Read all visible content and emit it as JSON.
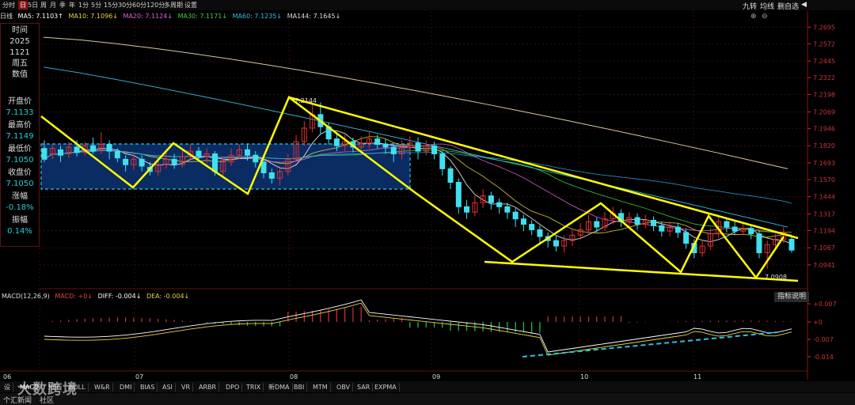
{
  "toolbar": {
    "items": [
      "分时",
      "日",
      "5日",
      "周",
      "月",
      "季",
      "年",
      "1分",
      "5分",
      "15分",
      "30分",
      "60分",
      "120分",
      "多周期",
      "设置"
    ],
    "active": "日",
    "right": [
      "九转",
      "均线",
      "删自选"
    ]
  },
  "ma_line": {
    "period": "日线",
    "ma5": "MA5: 7.1103↑",
    "ma10": "MA10: 7.1096↓",
    "ma20": "MA20: 7.1124↓",
    "ma30": "MA30: 7.1171↓",
    "ma60": "MA60: 7.1235↓",
    "ma144": "MA144: 7.1645↓",
    "colors": {
      "ma5": "#ffffff",
      "ma10": "#e8d23a",
      "ma20": "#e060e0",
      "ma30": "#40d040",
      "ma60": "#4080ff",
      "ma144": "#c0a060"
    }
  },
  "sidebar": {
    "time_label": "时间",
    "year": "2025",
    "monthday": "1121",
    "weekday": "周五",
    "value_label": "数值",
    "open_label": "开盘价",
    "open": "7.1133",
    "high_label": "最高价",
    "high": "7.1149",
    "low_label": "最低价",
    "low": "7.1050",
    "close_label": "收盘价",
    "close": "7.1050",
    "change_label": "涨幅",
    "change": "-0.18%",
    "amp_label": "振幅",
    "amp": "0.14%"
  },
  "annotations": {
    "high_mark": "7.2144",
    "low_mark": "7.0908"
  },
  "macd": {
    "title": "MACD(12,26,9)",
    "macd": "MACD: +0↓",
    "diff": "DIFF: -0.004↓",
    "dea": "DEA: -0.004↓",
    "doc_button": "指标说明",
    "yticks": [
      "+0.007",
      "+0",
      "-0.007",
      "-0.014"
    ]
  },
  "indicator_tabs": [
    "设",
    "MACD",
    "RSI",
    "BOLL",
    "W&R",
    "DMI",
    "BIAS",
    "ASI",
    "VR",
    "ARBR",
    "DPO",
    "TRIX",
    "新DMA",
    "BBI",
    "MTM",
    "OBV",
    "SAR",
    "EXPMA"
  ],
  "active_tab": "MACD",
  "footer": {
    "news": "个汇新闻",
    "community": "社区"
  },
  "watermark": "大数跨境",
  "chart_data": {
    "type": "candlestick",
    "ylim": [
      7.087,
      7.272
    ],
    "yticks": [
      7.2695,
      7.2572,
      7.2445,
      7.2322,
      7.2198,
      7.2069,
      7.1946,
      7.182,
      7.1693,
      7.157,
      7.1444,
      7.1317,
      7.1194,
      7.1067,
      7.0941
    ],
    "months": [
      "06",
      "07",
      "08",
      "09",
      "10",
      "11"
    ],
    "candles": [
      [
        7.18,
        7.172,
        7.186,
        7.17
      ],
      [
        7.176,
        7.18,
        7.183,
        7.172
      ],
      [
        7.179,
        7.175,
        7.182,
        7.17
      ],
      [
        7.176,
        7.181,
        7.185,
        7.173
      ],
      [
        7.181,
        7.177,
        7.186,
        7.174
      ],
      [
        7.177,
        7.182,
        7.185,
        7.175
      ],
      [
        7.182,
        7.178,
        7.188,
        7.176
      ],
      [
        7.179,
        7.183,
        7.192,
        7.176
      ],
      [
        7.183,
        7.178,
        7.186,
        7.172
      ],
      [
        7.178,
        7.173,
        7.18,
        7.17
      ],
      [
        7.172,
        7.168,
        7.175,
        7.163
      ],
      [
        7.168,
        7.172,
        7.176,
        7.164
      ],
      [
        7.172,
        7.167,
        7.175,
        7.163
      ],
      [
        7.166,
        7.163,
        7.17,
        7.16
      ],
      [
        7.163,
        7.168,
        7.172,
        7.16
      ],
      [
        7.168,
        7.172,
        7.177,
        7.165
      ],
      [
        7.172,
        7.168,
        7.176,
        7.165
      ],
      [
        7.168,
        7.174,
        7.179,
        7.166
      ],
      [
        7.174,
        7.178,
        7.183,
        7.171
      ],
      [
        7.178,
        7.174,
        7.181,
        7.17
      ],
      [
        7.174,
        7.176,
        7.18,
        7.169
      ],
      [
        7.176,
        7.163,
        7.178,
        7.16
      ],
      [
        7.163,
        7.17,
        7.174,
        7.16
      ],
      [
        7.17,
        7.175,
        7.18,
        7.167
      ],
      [
        7.175,
        7.179,
        7.183,
        7.172
      ],
      [
        7.179,
        7.175,
        7.183,
        7.171
      ],
      [
        7.175,
        7.17,
        7.178,
        7.166
      ],
      [
        7.17,
        7.162,
        7.173,
        7.158
      ],
      [
        7.162,
        7.158,
        7.165,
        7.154
      ],
      [
        7.158,
        7.163,
        7.167,
        7.153
      ],
      [
        7.163,
        7.172,
        7.176,
        7.16
      ],
      [
        7.172,
        7.185,
        7.19,
        7.17
      ],
      [
        7.185,
        7.195,
        7.2,
        7.182
      ],
      [
        7.195,
        7.205,
        7.212,
        7.192
      ],
      [
        7.205,
        7.196,
        7.214,
        7.19
      ],
      [
        7.196,
        7.187,
        7.199,
        7.183
      ],
      [
        7.187,
        7.182,
        7.192,
        7.178
      ],
      [
        7.182,
        7.185,
        7.19,
        7.178
      ],
      [
        7.185,
        7.181,
        7.188,
        7.177
      ],
      [
        7.181,
        7.184,
        7.189,
        7.178
      ],
      [
        7.184,
        7.187,
        7.192,
        7.18
      ],
      [
        7.187,
        7.183,
        7.19,
        7.18
      ],
      [
        7.183,
        7.181,
        7.187,
        7.176
      ],
      [
        7.181,
        7.176,
        7.184,
        7.17
      ],
      [
        7.176,
        7.181,
        7.186,
        7.172
      ],
      [
        7.181,
        7.184,
        7.189,
        7.177
      ],
      [
        7.184,
        7.178,
        7.188,
        7.172
      ],
      [
        7.178,
        7.182,
        7.186,
        7.175
      ],
      [
        7.182,
        7.176,
        7.185,
        7.172
      ],
      [
        7.176,
        7.165,
        7.178,
        7.16
      ],
      [
        7.165,
        7.155,
        7.167,
        7.15
      ],
      [
        7.155,
        7.137,
        7.158,
        7.132
      ],
      [
        7.137,
        7.133,
        7.142,
        7.128
      ],
      [
        7.133,
        7.14,
        7.145,
        7.13
      ],
      [
        7.14,
        7.145,
        7.15,
        7.136
      ],
      [
        7.145,
        7.14,
        7.148,
        7.135
      ],
      [
        7.14,
        7.137,
        7.143,
        7.132
      ],
      [
        7.137,
        7.133,
        7.14,
        7.128
      ],
      [
        7.133,
        7.128,
        7.136,
        7.122
      ],
      [
        7.128,
        7.124,
        7.131,
        7.119
      ],
      [
        7.124,
        7.12,
        7.127,
        7.116
      ],
      [
        7.12,
        7.115,
        7.123,
        7.11
      ],
      [
        7.115,
        7.112,
        7.118,
        7.107
      ],
      [
        7.112,
        7.108,
        7.116,
        7.104
      ],
      [
        7.108,
        7.112,
        7.116,
        7.103
      ],
      [
        7.112,
        7.116,
        7.121,
        7.108
      ],
      [
        7.116,
        7.12,
        7.125,
        7.113
      ],
      [
        7.12,
        7.126,
        7.131,
        7.117
      ],
      [
        7.126,
        7.122,
        7.129,
        7.118
      ],
      [
        7.122,
        7.128,
        7.133,
        7.119
      ],
      [
        7.128,
        7.132,
        7.137,
        7.124
      ],
      [
        7.132,
        7.126,
        7.135,
        7.122
      ],
      [
        7.126,
        7.129,
        7.133,
        7.122
      ],
      [
        7.129,
        7.124,
        7.132,
        7.12
      ],
      [
        7.124,
        7.127,
        7.131,
        7.121
      ],
      [
        7.127,
        7.123,
        7.13,
        7.119
      ],
      [
        7.123,
        7.119,
        7.126,
        7.115
      ],
      [
        7.119,
        7.122,
        7.126,
        7.115
      ],
      [
        7.122,
        7.118,
        7.125,
        7.114
      ],
      [
        7.118,
        7.11,
        7.121,
        7.106
      ],
      [
        7.11,
        7.103,
        7.113,
        7.099
      ],
      [
        7.103,
        7.108,
        7.112,
        7.1
      ],
      [
        7.108,
        7.117,
        7.121,
        7.105
      ],
      [
        7.117,
        7.126,
        7.13,
        7.114
      ],
      [
        7.126,
        7.122,
        7.129,
        7.118
      ],
      [
        7.122,
        7.119,
        7.126,
        7.116
      ],
      [
        7.119,
        7.121,
        7.125,
        7.116
      ],
      [
        7.121,
        7.117,
        7.124,
        7.113
      ],
      [
        7.117,
        7.103,
        7.12,
        7.099
      ],
      [
        7.103,
        7.109,
        7.112,
        7.091
      ],
      [
        7.109,
        7.113,
        7.117,
        7.105
      ],
      [
        7.113,
        7.118,
        7.122,
        7.11
      ],
      [
        7.113,
        7.105,
        7.115,
        7.103
      ]
    ],
    "drawn_lines": [
      {
        "type": "zigzag",
        "color": "#ffff00"
      },
      {
        "type": "trend_top",
        "color": "#ffff00"
      },
      {
        "type": "trend_bottom",
        "color": "#ffff00"
      },
      {
        "type": "macd_trend",
        "color": "#30c0e0"
      }
    ]
  }
}
